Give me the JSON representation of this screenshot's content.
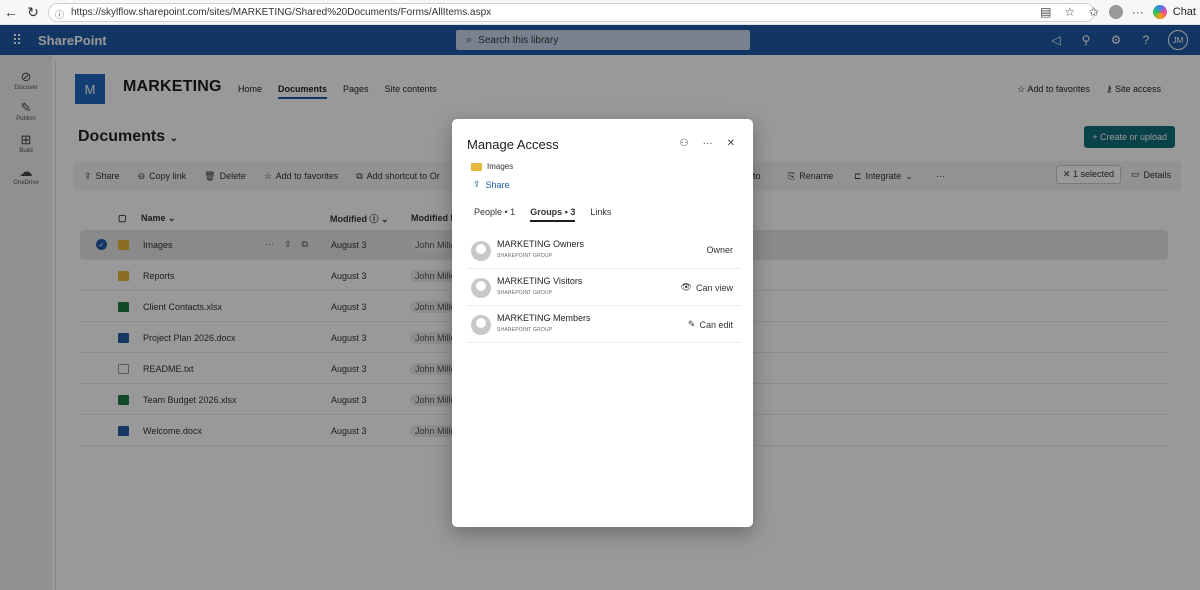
{
  "browser": {
    "url": "https://skylflow.sharepoint.com/sites/MARKETING/Shared%20Documents/Forms/AllItems.aspx",
    "chat_label": "Chat"
  },
  "suite": {
    "brand": "SharePoint",
    "search_placeholder": "Search this library",
    "user_initials": "JM",
    "brand_color": "#1e5aa6"
  },
  "app_bar": [
    {
      "label": "Discover",
      "icon": "compass-icon"
    },
    {
      "label": "Publish",
      "icon": "pen-icon"
    },
    {
      "label": "Build",
      "icon": "grid-icon"
    },
    {
      "label": "OneDrive",
      "icon": "cloud-icon"
    }
  ],
  "site": {
    "logo_letter": "M",
    "title": "MARKETING",
    "nav": [
      "Home",
      "Documents",
      "Pages",
      "Site contents"
    ],
    "active_nav": "Documents",
    "add_favorites": "Add to favorites",
    "site_access": "Site access"
  },
  "library": {
    "title": "Documents",
    "create_label": "Create or upload"
  },
  "command_bar": {
    "share": "Share",
    "copy_link": "Copy link",
    "delete": "Delete",
    "add_favorites": "Add to favorites",
    "add_shortcut": "Add shortcut to Or",
    "copy_to": "y to",
    "rename": "Rename",
    "integrate": "Integrate",
    "more": "···",
    "selected": "1 selected",
    "details": "Details"
  },
  "list": {
    "headers": {
      "name": "Name",
      "modified": "Modified",
      "modified_by": "Modified B"
    },
    "rows": [
      {
        "name": "Images",
        "type": "folder",
        "modified": "August 3",
        "by": "John Mille",
        "selected": true
      },
      {
        "name": "Reports",
        "type": "folder",
        "modified": "August 3",
        "by": "John Mille",
        "selected": false
      },
      {
        "name": "Client Contacts.xlsx",
        "type": "xlsx",
        "modified": "August 3",
        "by": "John Mille",
        "selected": false
      },
      {
        "name": "Project Plan 2026.docx",
        "type": "docx",
        "modified": "August 3",
        "by": "John Mille",
        "selected": false
      },
      {
        "name": "README.txt",
        "type": "txt",
        "modified": "August 3",
        "by": "John Mille",
        "selected": false
      },
      {
        "name": "Team Budget 2026.xlsx",
        "type": "xlsx",
        "modified": "August 3",
        "by": "John Mille",
        "selected": false
      },
      {
        "name": "Welcome.docx",
        "type": "docx",
        "modified": "August 3",
        "by": "John Mille",
        "selected": false
      }
    ]
  },
  "dialog": {
    "title": "Manage Access",
    "item_name": "Images",
    "share_label": "Share",
    "tabs": [
      {
        "label": "People • 1",
        "active": false
      },
      {
        "label": "Groups • 3",
        "active": true
      },
      {
        "label": "Links",
        "active": false
      }
    ],
    "groups": [
      {
        "name": "MARKETING Owners",
        "sub": "SHAREPOINT GROUP",
        "permission": "Owner",
        "perm_icon": ""
      },
      {
        "name": "MARKETING Visitors",
        "sub": "SHAREPOINT GROUP",
        "permission": "Can view",
        "perm_icon": "eye-icon"
      },
      {
        "name": "MARKETING Members",
        "sub": "SHAREPOINT GROUP",
        "permission": "Can edit",
        "perm_icon": "pencil-icon"
      }
    ]
  }
}
